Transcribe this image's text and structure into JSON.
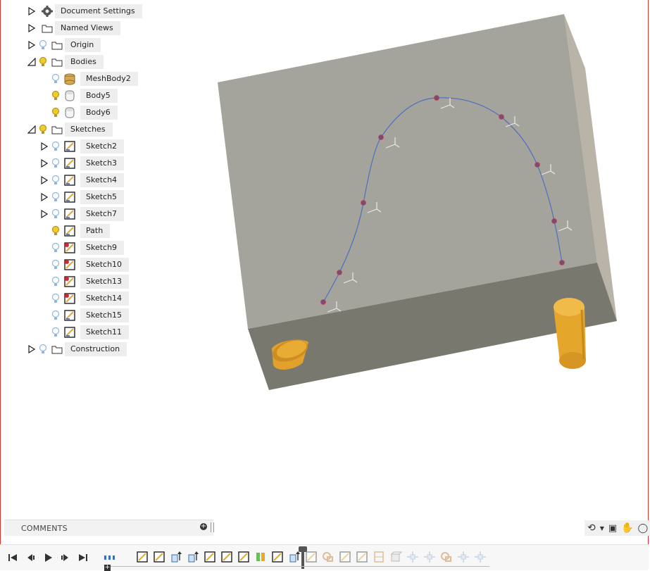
{
  "browser": {
    "items": [
      {
        "label": "Document Settings",
        "icon": "gear-icon",
        "expand": "collapsed",
        "visibility": "none"
      },
      {
        "label": "Named Views",
        "icon": "folder-icon",
        "expand": "collapsed",
        "visibility": "none"
      },
      {
        "label": "Origin",
        "icon": "folder-icon",
        "expand": "collapsed",
        "visibility": "off"
      },
      {
        "label": "Bodies",
        "icon": "folder-icon",
        "expand": "expanded",
        "visibility": "on"
      },
      {
        "label": "MeshBody2",
        "icon": "mesh-body-icon",
        "expand": "none",
        "visibility": "off"
      },
      {
        "label": "Body5",
        "icon": "body-icon",
        "expand": "none",
        "visibility": "on"
      },
      {
        "label": "Body6",
        "icon": "body-icon",
        "expand": "none",
        "visibility": "on"
      },
      {
        "label": "Sketches",
        "icon": "folder-icon",
        "expand": "expanded",
        "visibility": "on"
      },
      {
        "label": "Sketch2",
        "icon": "sketch-icon",
        "expand": "collapsed",
        "visibility": "off"
      },
      {
        "label": "Sketch3",
        "icon": "sketch-icon",
        "expand": "collapsed",
        "visibility": "off"
      },
      {
        "label": "Sketch4",
        "icon": "sketch-icon",
        "expand": "collapsed",
        "visibility": "off"
      },
      {
        "label": "Sketch5",
        "icon": "sketch-icon",
        "expand": "collapsed",
        "visibility": "off"
      },
      {
        "label": "Sketch7",
        "icon": "sketch-icon",
        "expand": "collapsed",
        "visibility": "off"
      },
      {
        "label": "Path",
        "icon": "sketch-icon",
        "expand": "none",
        "visibility": "on"
      },
      {
        "label": "Sketch9",
        "icon": "sketch-error-icon",
        "expand": "none",
        "visibility": "off"
      },
      {
        "label": "Sketch10",
        "icon": "sketch-error-icon",
        "expand": "none",
        "visibility": "off"
      },
      {
        "label": "Sketch13",
        "icon": "sketch-error-icon",
        "expand": "none",
        "visibility": "off"
      },
      {
        "label": "Sketch14",
        "icon": "sketch-error-icon",
        "expand": "none",
        "visibility": "off"
      },
      {
        "label": "Sketch15",
        "icon": "sketch-icon",
        "expand": "none",
        "visibility": "off"
      },
      {
        "label": "Sketch11",
        "icon": "sketch-icon",
        "expand": "none",
        "visibility": "off"
      },
      {
        "label": "Construction",
        "icon": "folder-icon",
        "expand": "collapsed",
        "visibility": "off"
      }
    ]
  },
  "comments": {
    "title": "COMMENTS"
  },
  "nav_tools": [
    "orbit-icon",
    "look-at-icon",
    "pan-hand-icon",
    "zoom-icon"
  ],
  "timeline": {
    "playback": [
      "go-to-start-icon",
      "step-back-icon",
      "play-icon",
      "step-forward-icon",
      "go-to-end-icon"
    ],
    "features": [
      "sketch",
      "sketch",
      "extrude",
      "extrude",
      "sketch",
      "sketch",
      "sketch",
      "split",
      "sketch",
      "extrude",
      "sketch",
      "combine",
      "sketch",
      "sketch",
      "section",
      "body",
      "move",
      "move",
      "align",
      "move",
      "move"
    ]
  },
  "colors": {
    "block_top": "#a6a59d",
    "block_front": "#79786f",
    "block_side": "#b9b4a6",
    "cylinder": "#e5a62c",
    "path_curve": "#4c6fbe",
    "bulb_on": "#f0cc2a",
    "bulb_off": "#8ab6e6",
    "frame": "#d9332b"
  }
}
